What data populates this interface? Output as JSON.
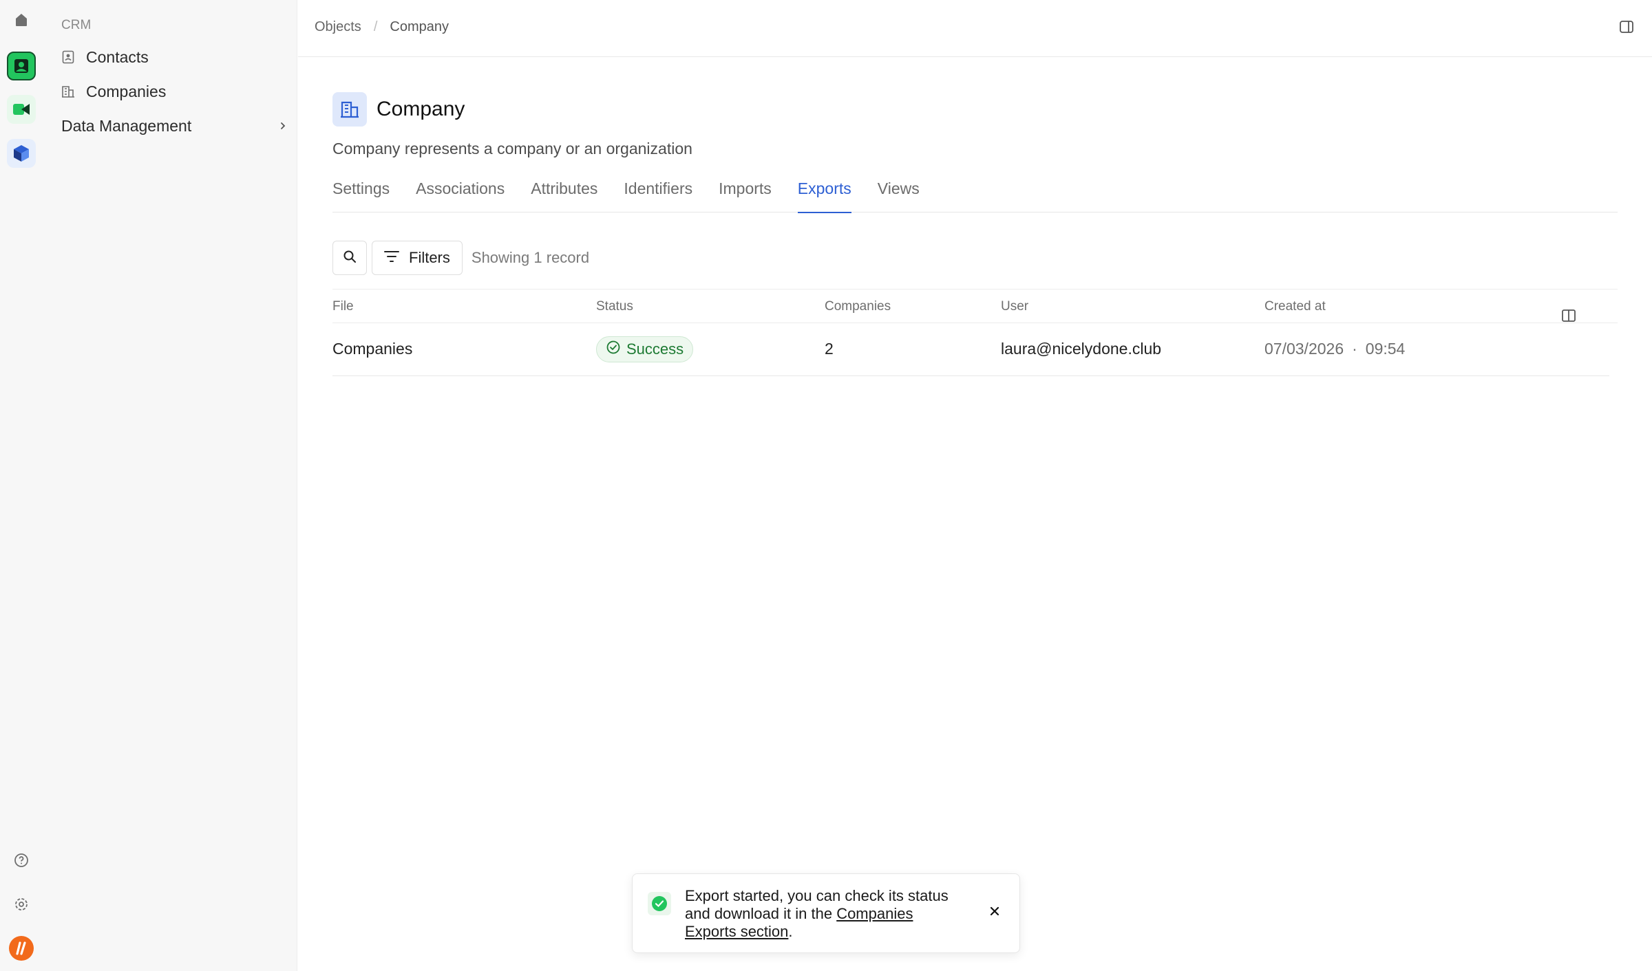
{
  "rail": {
    "icons": [
      "home-icon",
      "crm-app-icon",
      "meet-app-icon",
      "layers-app-icon",
      "help-icon",
      "settings-icon",
      "user-avatar-icon"
    ]
  },
  "sidebar": {
    "section": "CRM",
    "items": [
      {
        "label": "Contacts",
        "icon": "contacts-icon"
      },
      {
        "label": "Companies",
        "icon": "companies-icon"
      },
      {
        "label": "Data Management",
        "icon": "chevron-right-icon"
      }
    ]
  },
  "breadcrumb": {
    "items": [
      "Objects",
      "Company"
    ],
    "separator": "/"
  },
  "header": {
    "title": "Company",
    "description": "Company represents a company or an organization"
  },
  "tabs": [
    "Settings",
    "Associations",
    "Attributes",
    "Identifiers",
    "Imports",
    "Exports",
    "Views"
  ],
  "active_tab": "Exports",
  "toolbar": {
    "filters_label": "Filters",
    "count_text": "Showing 1 record"
  },
  "table": {
    "columns": [
      "File",
      "Status",
      "Companies",
      "User",
      "Created at"
    ],
    "rows": [
      {
        "file": "Companies",
        "status": "Success",
        "companies": "2",
        "user": "laura@nicelydone.club",
        "date": "07/03/2026",
        "time": "09:54"
      }
    ]
  },
  "toast": {
    "text": "Export started, you can check its status and download it in the",
    "link": "Companies Exports section",
    "suffix": "."
  },
  "colors": {
    "accent": "#2d5fd3",
    "success": "#1d7a33",
    "crm_app": "#22c55e"
  }
}
